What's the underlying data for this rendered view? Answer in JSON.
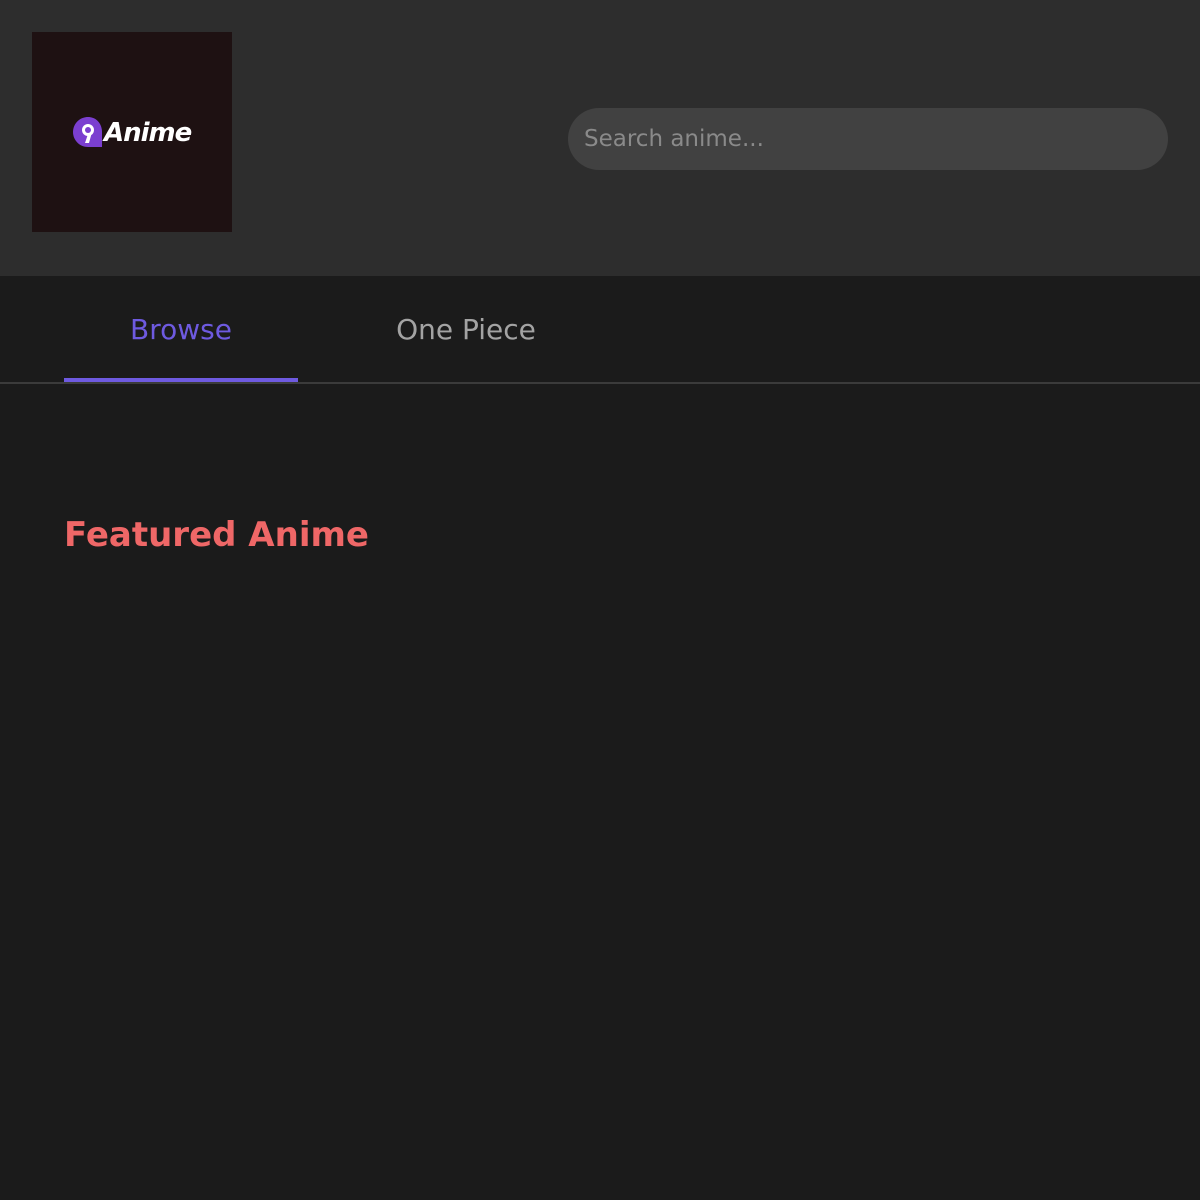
{
  "header": {
    "logo": {
      "text": "Anime",
      "mark_glyph": "9",
      "mark_color": "#7b3fd0"
    },
    "search": {
      "placeholder": "Search anime...",
      "value": ""
    }
  },
  "tabs": [
    {
      "label": "Browse",
      "active": true
    },
    {
      "label": "One Piece",
      "active": false
    }
  ],
  "main": {
    "section_title": "Featured Anime"
  },
  "colors": {
    "accent": "#6e5ae0",
    "title": "#ef6767",
    "header_bg": "#2d2d2d",
    "page_bg": "#1b1b1b"
  }
}
